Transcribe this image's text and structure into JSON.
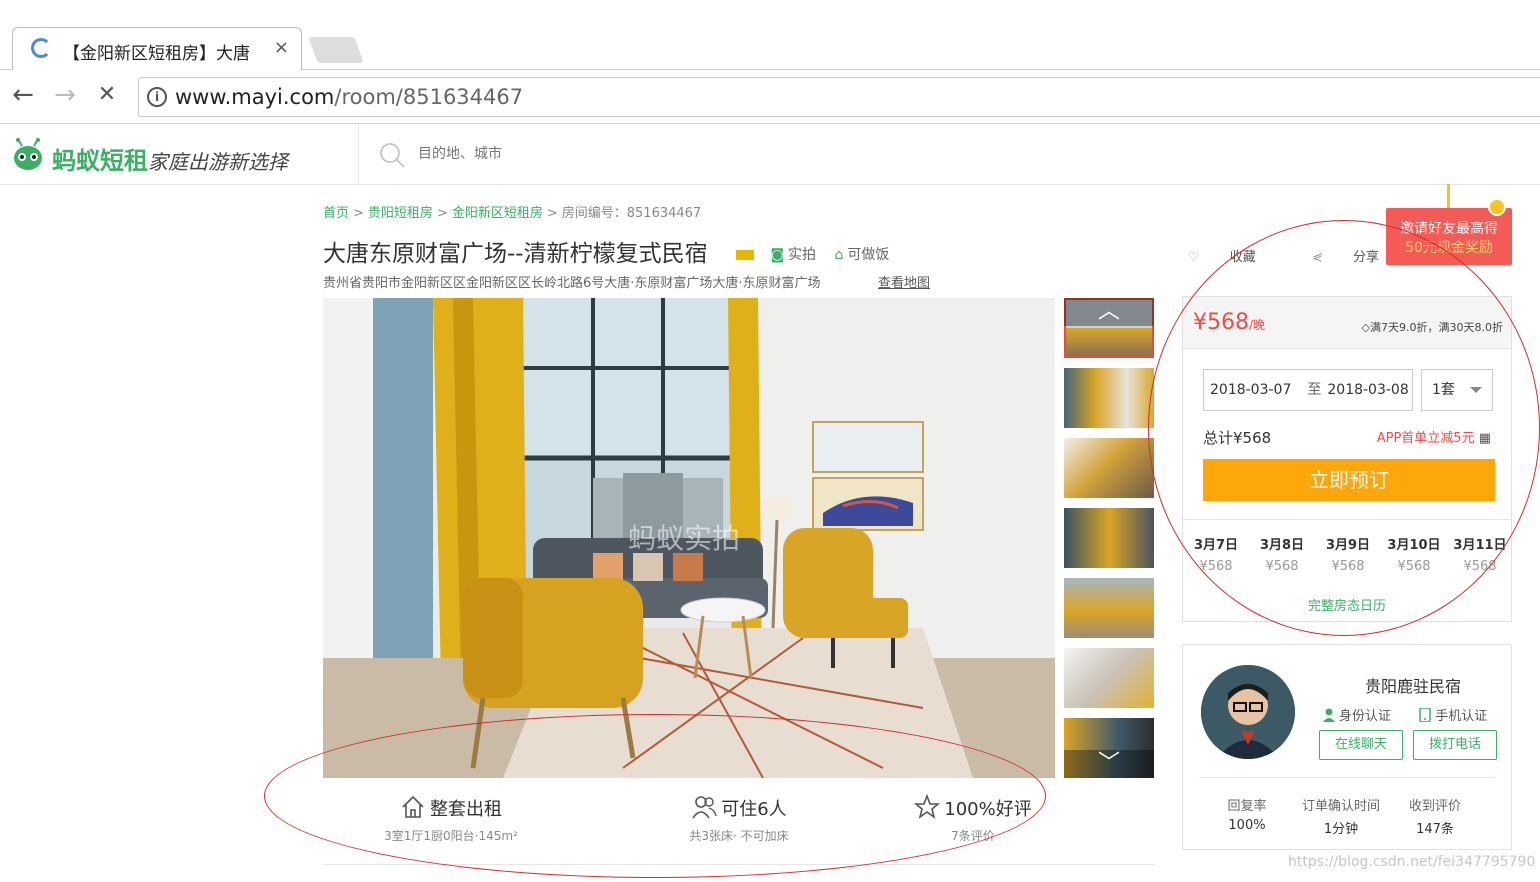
{
  "browser": {
    "tab_title": "【金阳新区短租房】大唐",
    "tab_close": "×",
    "url_host": "www.mayi.com",
    "url_path": "/room/851634467",
    "back": "←",
    "forward": "→",
    "stop": "✕",
    "info": "i"
  },
  "header": {
    "logo_text": "蚂蚁短租",
    "slogan": "家庭出游新选择",
    "search_placeholder": "目的地、城市"
  },
  "breadcrumb": {
    "items": [
      "首页",
      "贵阳短租房",
      "金阳新区短租房"
    ],
    "sep": ">",
    "room_id": "房间编号：851634467"
  },
  "room": {
    "title": "大唐东原财富广场--清新柠檬复式民宿",
    "badge_real": "实拍",
    "badge_cook": "可做饭",
    "address": "贵州省贵阳市金阳新区区金阳新区区长岭北路6号大唐·东原财富广场大唐·东原财富广场",
    "map_link": "查看地图",
    "favorite": "收藏",
    "share": "分享",
    "photo_watermark": "蚂蚁实拍"
  },
  "thumbs": {
    "up": "︿",
    "down": "﹀"
  },
  "features": [
    {
      "main": "整套出租",
      "sub": "3室1厅1厨0阳台·145m²",
      "icon": "house-icon"
    },
    {
      "main": "可住6人",
      "sub": "共3张床· 不可加床",
      "icon": "people-icon"
    },
    {
      "main": "100%好评",
      "sub": "7条评价",
      "icon": "star-icon"
    }
  ],
  "promo": {
    "line1": "邀请好友最高得",
    "line2": "50元现金奖励"
  },
  "booking": {
    "price": "¥568",
    "price_unit": "/晚",
    "discount": "满7天9.0折，满30天8.0折",
    "checkin": "2018-03-07",
    "to": "至",
    "checkout": "2018-03-08",
    "qty": "1套",
    "total": "总计¥568",
    "app_offer": "APP首单立减5元",
    "book_button": "立即预订",
    "calendar": [
      {
        "date": "3月7日",
        "price": "¥568"
      },
      {
        "date": "3月8日",
        "price": "¥568"
      },
      {
        "date": "3月9日",
        "price": "¥568"
      },
      {
        "date": "3月10日",
        "price": "¥568"
      },
      {
        "date": "3月11日",
        "price": "¥568"
      }
    ],
    "calendar_link": "完整房态日历"
  },
  "host": {
    "name": "贵阳鹿驻民宿",
    "id_verified": "身份认证",
    "phone_verified": "手机认证",
    "chat_button": "在线聊天",
    "call_button": "拨打电话",
    "stats": [
      {
        "label": "回复率",
        "value": "100%"
      },
      {
        "label": "订单确认时间",
        "value": "1分钟"
      },
      {
        "label": "收到评价",
        "value": "147条"
      }
    ]
  },
  "watermark": "https://blog.csdn.net/fei347795790",
  "colors": {
    "brand_green": "#3cae66",
    "price_red": "#f24b45",
    "book_orange": "#fda70b",
    "annotation_red": "#d52b2b"
  }
}
